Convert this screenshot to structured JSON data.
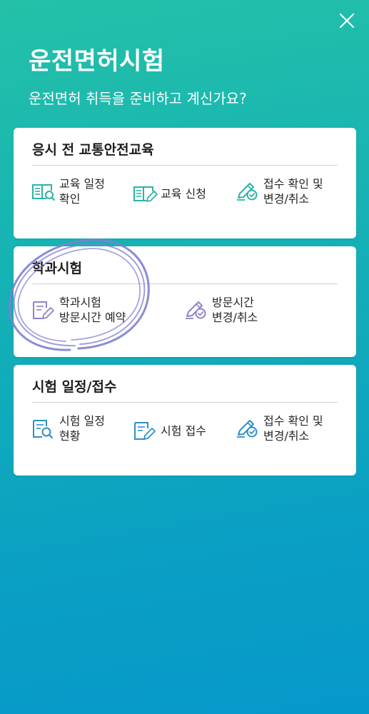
{
  "header": {
    "title": "운전면허시험",
    "subtitle": "운전면허 취득을 준비하고 계신가요?"
  },
  "colors": {
    "background_top": "#24c1a8",
    "background_bottom": "#0598ca",
    "icon_teal": "#2bb3a4",
    "icon_purple": "#8e84c9",
    "icon_blue": "#2f8fc4",
    "annotation": "#7d7fd0"
  },
  "sections": [
    {
      "title": "응시 전 교통안전교육",
      "items": [
        {
          "label": "교육 일정\n확인",
          "icon": "book-search-icon"
        },
        {
          "label": "교육 신청",
          "icon": "book-edit-icon"
        },
        {
          "label": "접수 확인 및\n변경/취소",
          "icon": "pen-check-icon"
        }
      ]
    },
    {
      "title": "학과시험",
      "items": [
        {
          "label": "학과시험\n방문시간 예약",
          "icon": "document-pen-icon"
        },
        {
          "label": "방문시간\n변경/취소",
          "icon": "pen-check-icon"
        }
      ]
    },
    {
      "title": "시험 일정/접수",
      "items": [
        {
          "label": "시험 일정\n현황",
          "icon": "document-search-icon"
        },
        {
          "label": "시험 접수",
          "icon": "document-pen-icon"
        },
        {
          "label": "접수 확인 및\n변경/취소",
          "icon": "pen-check-icon"
        }
      ]
    }
  ]
}
